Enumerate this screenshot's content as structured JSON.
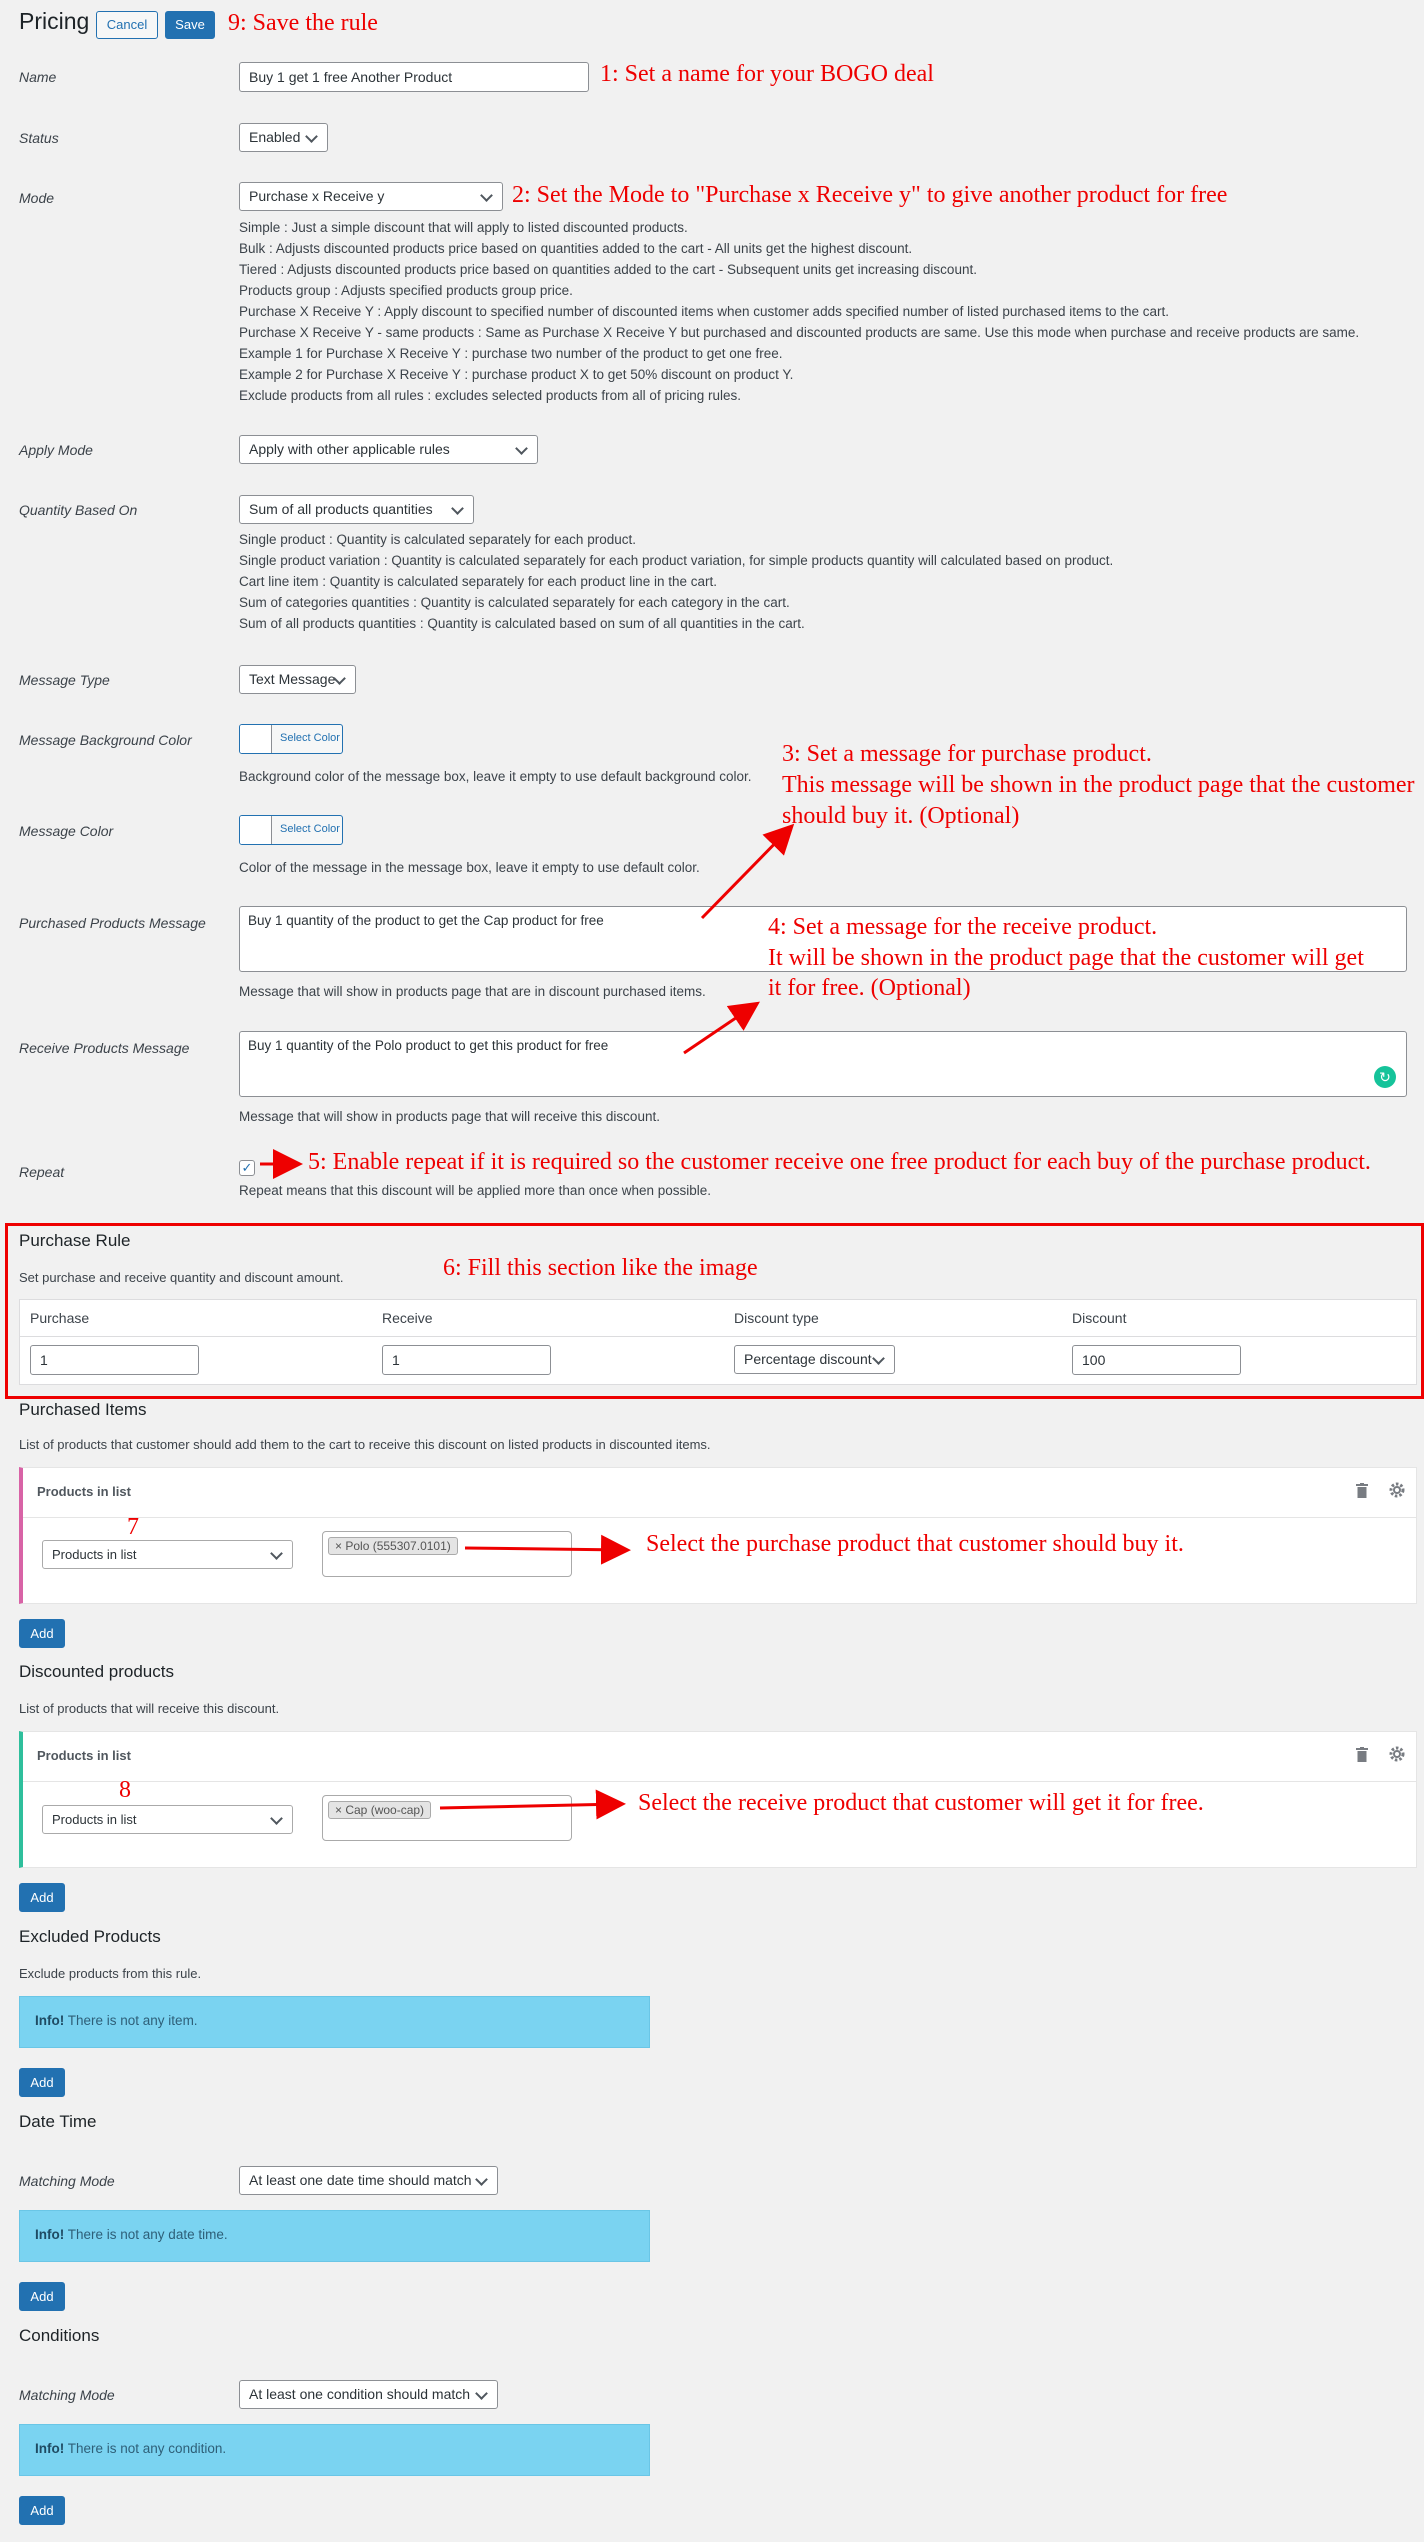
{
  "header": {
    "title": "Pricing",
    "cancel_label": "Cancel",
    "save_label": "Save"
  },
  "fields": {
    "name": {
      "label": "Name",
      "value": "Buy 1 get 1 free Another Product"
    },
    "status": {
      "label": "Status",
      "value": "Enabled"
    },
    "mode": {
      "label": "Mode",
      "value": "Purchase x Receive y",
      "help": [
        "Simple : Just a simple discount that will apply to listed discounted products.",
        "Bulk : Adjusts discounted products price based on quantities added to the cart - All units get the highest discount.",
        "Tiered : Adjusts discounted products price based on quantities added to the cart - Subsequent units get increasing discount.",
        "Products group : Adjusts specified products group price.",
        "Purchase X Receive Y : Apply discount to specified number of discounted items when customer adds specified number of listed purchased items to the cart.",
        "Purchase X Receive Y - same products : Same as Purchase X Receive Y but purchased and discounted products are same. Use this mode when purchase and receive products are same.",
        "Example 1 for Purchase X Receive Y : purchase two number of the product to get one free.",
        "Example 2 for Purchase X Receive Y : purchase product X to get 50% discount on product Y.",
        "Exclude products from all rules : excludes selected products from all of pricing rules."
      ]
    },
    "apply_mode": {
      "label": "Apply Mode",
      "value": "Apply with other applicable rules"
    },
    "quantity_based_on": {
      "label": "Quantity Based On",
      "value": "Sum of all products quantities",
      "help": [
        "Single product : Quantity is calculated separately for each product.",
        "Single product variation : Quantity is calculated separately for each product variation, for simple products quantity will calculated based on product.",
        "Cart line item : Quantity is calculated separately for each product line in the cart.",
        "Sum of categories quantities : Quantity is calculated separately for each category in the cart.",
        "Sum of all products quantities : Quantity is calculated based on sum of all quantities in the cart."
      ]
    },
    "message_type": {
      "label": "Message Type",
      "value": "Text Message"
    },
    "message_bg_color": {
      "label": "Message Background Color",
      "button": "Select Color",
      "help": "Background color of the message box, leave it empty to use default background color."
    },
    "message_color": {
      "label": "Message Color",
      "button": "Select Color",
      "help": "Color of the message in the message box, leave it empty to use default color."
    },
    "purchased_message": {
      "label": "Purchased Products Message",
      "value": "Buy 1 quantity of the product to get the Cap product for free",
      "help": "Message that will show in products page that are in discount purchased items."
    },
    "receive_message": {
      "label": "Receive Products Message",
      "value": "Buy 1 quantity of the Polo product to get this product for free",
      "help": "Message that will show in products page that will receive this discount."
    },
    "repeat": {
      "label": "Repeat",
      "help": "Repeat means that this discount will be applied more than once when possible."
    }
  },
  "purchase_rule": {
    "title": "Purchase Rule",
    "subtitle": "Set purchase and receive quantity and discount amount.",
    "headers": [
      "Purchase",
      "Receive",
      "Discount type",
      "Discount"
    ],
    "values": {
      "purchase": "1",
      "receive": "1",
      "discount_type": "Percentage discount",
      "discount": "100"
    }
  },
  "purchased_items": {
    "title": "Purchased Items",
    "subtitle": "List of products that customer should add them to the cart to receive this discount on listed products in discounted items.",
    "card_title": "Products in list",
    "select": "Products in list",
    "tag": "Polo (555307.0101)",
    "add": "Add"
  },
  "discounted_products": {
    "title": "Discounted products",
    "subtitle": "List of products that will receive this discount.",
    "card_title": "Products in list",
    "select": "Products in list",
    "tag": "Cap (woo-cap)",
    "add": "Add"
  },
  "excluded_products": {
    "title": "Excluded Products",
    "subtitle": "Exclude products from this rule.",
    "info_strong": "Info!",
    "info_text": " There is not any item.",
    "add": "Add"
  },
  "date_time": {
    "title": "Date Time",
    "match_label": "Matching Mode",
    "match_value": "At least one date time should match",
    "info_strong": "Info!",
    "info_text": " There is not any date time.",
    "add": "Add"
  },
  "conditions": {
    "title": "Conditions",
    "match_label": "Matching Mode",
    "match_value": "At least one condition should match",
    "info_strong": "Info!",
    "info_text": " There is not any condition.",
    "add": "Add"
  },
  "annotations": {
    "a1": "1: Set a name for your BOGO deal",
    "a2": "2: Set the Mode to \"Purchase x Receive y\" to give another product for free",
    "a3": [
      "3: Set a message for purchase product.",
      "This message will be shown in the product page that the customer",
      "should buy it. (Optional)"
    ],
    "a4": [
      "4: Set a message for the receive product.",
      "It will be shown in the product page that the customer will get",
      "it for free. (Optional)"
    ],
    "a5": "5: Enable repeat if it is required so the customer receive one free product for each buy of the purchase product.",
    "a6": "6: Fill this section like the image",
    "a7": "7",
    "a7b": "Select the purchase product that customer should buy it.",
    "a8": "8",
    "a8b": "Select the receive product that customer will get it for free.",
    "a9": "9: Save the rule"
  },
  "colors": {
    "accent": "#2271b1",
    "annotation": "#e00000",
    "info": "#7ad3f1",
    "purchased_border": "#d863a6",
    "discounted_border": "#2ebf9c"
  }
}
